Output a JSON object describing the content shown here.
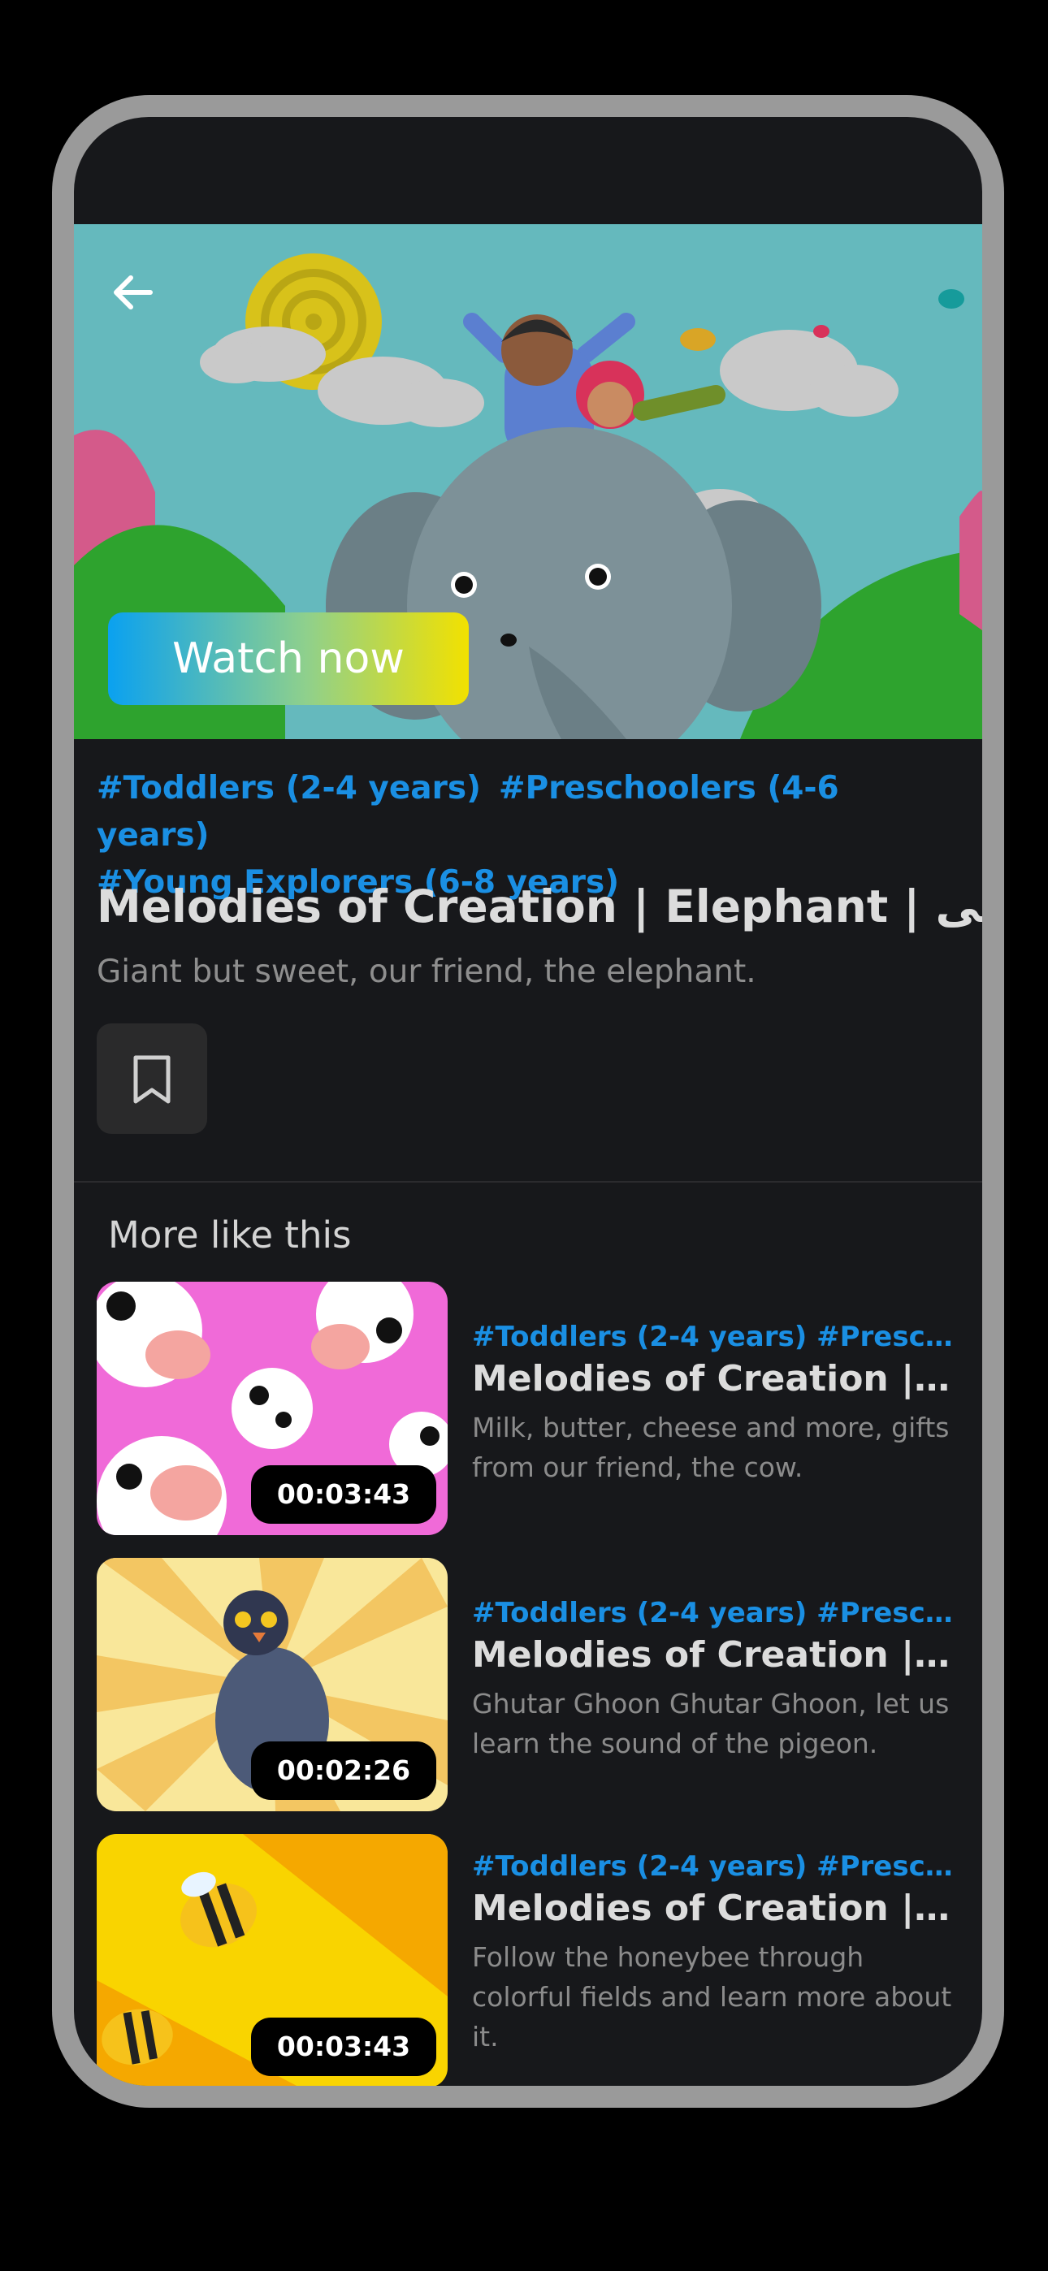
{
  "hero": {
    "watch_label": "Watch now",
    "back_icon": "back-arrow-icon",
    "colors": {
      "sky": "#65b9bd",
      "button_start": "#0aa1f0",
      "button_end": "#f2e100"
    }
  },
  "video": {
    "tags": [
      "#Toddlers (2-4 years)",
      "#Preschoolers (4-6 years)",
      "#Young Explorers (6-8 years)"
    ],
    "title": "Melodies of Creation | Elephant | ہاتھی",
    "description": "Giant but sweet, our friend, the elephant.",
    "bookmark_icon": "bookmark-icon"
  },
  "more": {
    "heading": "More like this",
    "items": [
      {
        "tags": "#Toddlers (2-4 years)  #Presc…",
        "title": "Melodies of Creation | C…",
        "description": "Milk, butter, cheese and more, gifts from our friend, the cow.",
        "duration": "00:03:43"
      },
      {
        "tags": "#Toddlers (2-4 years)  #Presc…",
        "title": "Melodies of Creation | Pi…",
        "description": "Ghutar Ghoon Ghutar Ghoon, let us learn the sound of the pigeon.",
        "duration": "00:02:26"
      },
      {
        "tags": "#Toddlers (2-4 years)  #Presc…",
        "title": "Melodies of Creation | H…",
        "description": "Follow the honeybee through colorful fields and learn more about it.",
        "duration": "00:03:43"
      }
    ]
  },
  "accent_color": "#1a8fe3"
}
